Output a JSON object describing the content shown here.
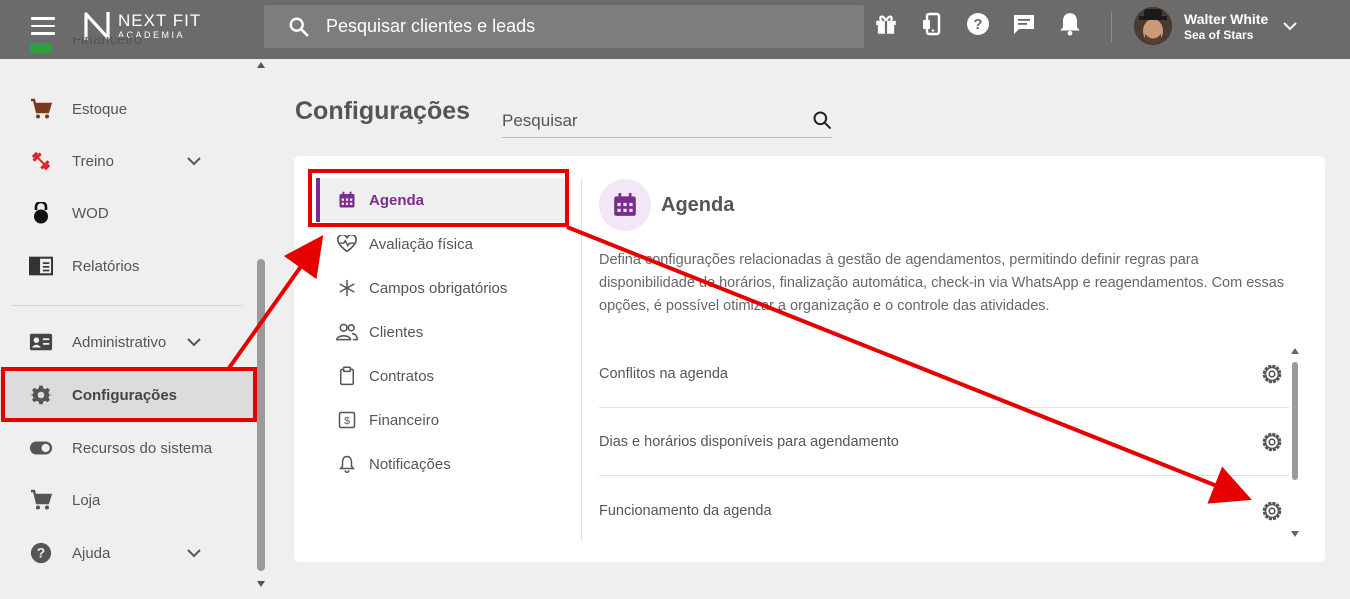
{
  "header": {
    "brand_line1": "NEXT FIT",
    "brand_line2": "ACADEMIA",
    "search_placeholder": "Pesquisar clientes e leads",
    "user_name": "Walter White",
    "user_org": "Sea of Stars"
  },
  "sidebar": {
    "partial_top": "Financeiro",
    "items": [
      {
        "label": "Estoque",
        "icon": "cart-icon"
      },
      {
        "label": "Treino",
        "icon": "dumbbell-icon"
      },
      {
        "label": "WOD",
        "icon": "kettlebell-icon"
      },
      {
        "label": "Relatórios",
        "icon": "report-icon"
      },
      {
        "label": "Administrativo",
        "icon": "id-card-icon"
      },
      {
        "label": "Configurações",
        "icon": "gear-icon"
      },
      {
        "label": "Recursos do sistema",
        "icon": "toggle-icon"
      },
      {
        "label": "Loja",
        "icon": "cart-icon"
      },
      {
        "label": "Ajuda",
        "icon": "help-icon"
      }
    ]
  },
  "main": {
    "title": "Configurações",
    "search_placeholder": "Pesquisar",
    "menu": [
      {
        "label": "Agenda",
        "icon": "calendar-icon"
      },
      {
        "label": "Avaliação física",
        "icon": "heart-pulse-icon"
      },
      {
        "label": "Campos obrigatórios",
        "icon": "asterisk-icon"
      },
      {
        "label": "Clientes",
        "icon": "users-icon"
      },
      {
        "label": "Contratos",
        "icon": "clipboard-icon"
      },
      {
        "label": "Financeiro",
        "icon": "dollar-icon"
      },
      {
        "label": "Notificações",
        "icon": "bell-icon"
      }
    ],
    "section": {
      "title": "Agenda",
      "description": "Defina configurações relacionadas à gestão de agendamentos, permitindo definir regras para disponibilidade de horários, finalização automática, check-in via WhatsApp e reagendamentos. Com essas opções, é possível otimizar a organização e o controle das atividades.",
      "rows": [
        "Conflitos na agenda",
        "Dias e horários disponíveis para agendamento",
        "Funcionamento da agenda"
      ]
    }
  },
  "colors": {
    "accent": "#7b2d8e",
    "topbar": "#6b6b6b",
    "annotation": "#e60000"
  }
}
